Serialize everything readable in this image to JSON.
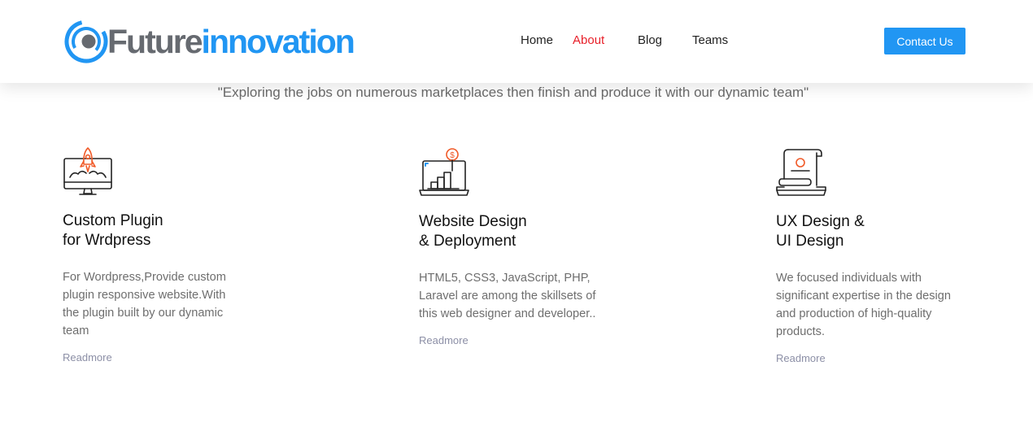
{
  "header": {
    "logo": {
      "part1": "Future",
      "part2": "innovation",
      "icon": "swirl-logo-icon"
    },
    "nav": [
      {
        "label": "Home"
      },
      {
        "label": "About",
        "active": true
      },
      {
        "label": "Blog"
      },
      {
        "label": "Teams"
      }
    ],
    "contact_label": "Contact Us"
  },
  "tagline": "\"Exploring the jobs on numerous marketplaces then finish and produce it with our dynamic team\"",
  "services": [
    {
      "icon": "rocket-monitor-icon",
      "title": "Custom Plugin\nfor Wrdpress",
      "description": "For Wordpress,Provide custom plugin responsive website.With the plugin built by our dynamic team",
      "link": "Readmore"
    },
    {
      "icon": "growth-chart-laptop-icon",
      "title": "Website Design\n& Deployment",
      "description": "HTML5, CSS3, JavaScript, PHP, Laravel are among the skillsets of this web designer and developer..",
      "link": "Readmore"
    },
    {
      "icon": "design-scroll-laptop-icon",
      "title": "UX Design &\nUI Design",
      "description": "We focused individuals with significant expertise in the design and production of high-quality products.",
      "link": "Readmore"
    }
  ],
  "colors": {
    "brand_blue": "#2196f3",
    "brand_gray": "#666a70",
    "active_nav": "#e8202a",
    "icon_accent": "#f05a28",
    "link": "#8c8fa6"
  }
}
